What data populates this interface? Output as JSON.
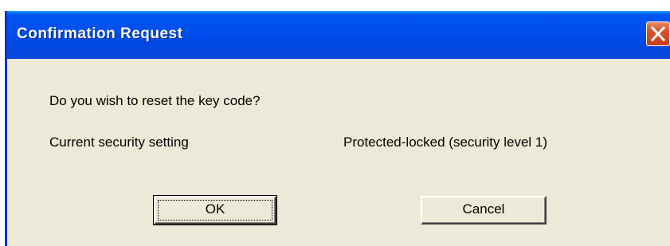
{
  "dialog": {
    "title": "Confirmation Request",
    "close_icon": "close-icon",
    "question": "Do you wish to reset the key code?",
    "setting_label": "Current security setting",
    "setting_value": "Protected-locked (security level 1)",
    "ok_label": "OK",
    "cancel_label": "Cancel"
  },
  "colors": {
    "titlebar": "#0050ee",
    "window_bg": "#ece9d8",
    "close_button": "#d9542b"
  }
}
